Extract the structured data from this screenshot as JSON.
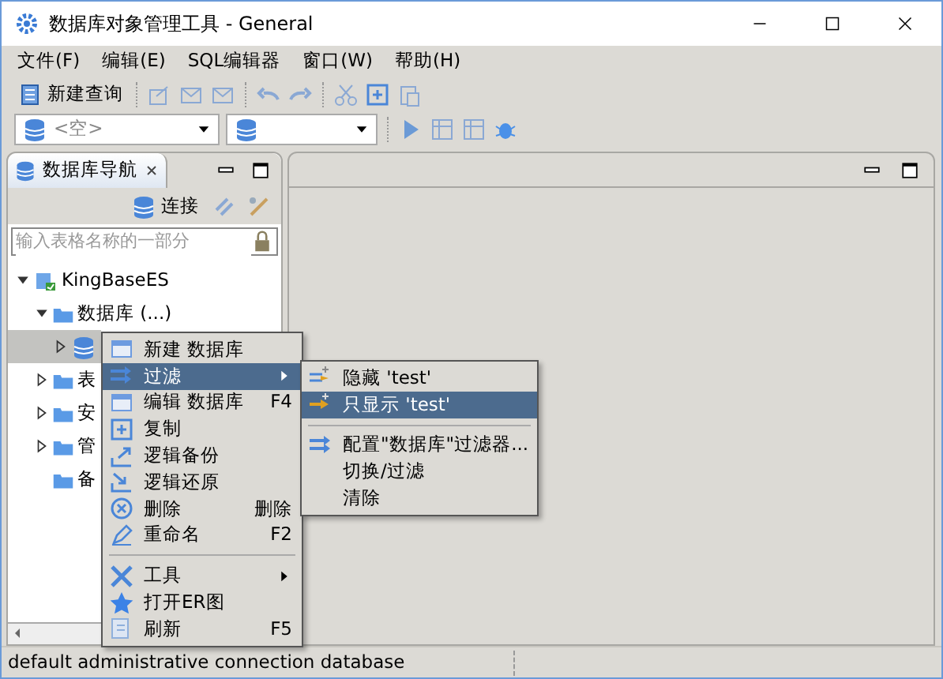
{
  "window": {
    "title": "数据库对象管理工具 - General"
  },
  "menu_bar": [
    {
      "label": "文件(F)"
    },
    {
      "label": "编辑(E)"
    },
    {
      "label": "SQL编辑器"
    },
    {
      "label": "窗口(W)"
    },
    {
      "label": "帮助(H)"
    }
  ],
  "toolbar": {
    "new_query": "新建查询"
  },
  "connection_selector": {
    "value": "<空>"
  },
  "navigator": {
    "title": "数据库导航",
    "connect": "连接",
    "search": {
      "placeholder": "输入表格名称的一部分"
    },
    "tree": [
      {
        "label": "KingBaseES",
        "expanded": true,
        "selected": false,
        "children": [
          {
            "label": "数据库 (...)",
            "expanded": true,
            "selected": false,
            "children": [
              {
                "expanded": false,
                "selected": true
              }
            ]
          },
          {
            "label": "表",
            "expanded": false,
            "selected": false
          },
          {
            "label": "安",
            "expanded": false,
            "selected": false
          },
          {
            "label": "管",
            "expanded": false,
            "selected": false
          },
          {
            "label": "备",
            "selected": false
          }
        ]
      }
    ]
  },
  "context_menu": [
    {
      "kind": "item",
      "label": "新建 数据库",
      "selected": false
    },
    {
      "kind": "item",
      "label": "过滤",
      "submenu": true,
      "selected": true
    },
    {
      "kind": "item",
      "label": "编辑 数据库",
      "shortcut": "F4",
      "selected": false
    },
    {
      "kind": "item",
      "label": "复制",
      "selected": false
    },
    {
      "kind": "item",
      "label": "逻辑备份",
      "selected": false
    },
    {
      "kind": "item",
      "label": "逻辑还原",
      "selected": false
    },
    {
      "kind": "item",
      "label": "删除",
      "shortcut": "删除",
      "selected": false
    },
    {
      "kind": "item",
      "label": "重命名",
      "shortcut": "F2",
      "selected": false
    },
    {
      "kind": "separator"
    },
    {
      "kind": "item",
      "label": "工具",
      "submenu": true,
      "selected": false
    },
    {
      "kind": "item",
      "label": "打开ER图",
      "selected": false
    },
    {
      "kind": "item",
      "label": "刷新",
      "shortcut": "F5",
      "selected": false
    }
  ],
  "submenu": [
    {
      "kind": "item",
      "label": "隐藏 'test'",
      "selected": false
    },
    {
      "kind": "item",
      "label": "只显示 'test'",
      "selected": true
    },
    {
      "kind": "separator"
    },
    {
      "kind": "item",
      "label": "配置\"数据库\"过滤器...",
      "selected": false
    },
    {
      "kind": "item",
      "label": "切换/过滤",
      "selected": false
    },
    {
      "kind": "item",
      "label": "清除",
      "selected": false
    }
  ],
  "status_bar": "default administrative connection database"
}
